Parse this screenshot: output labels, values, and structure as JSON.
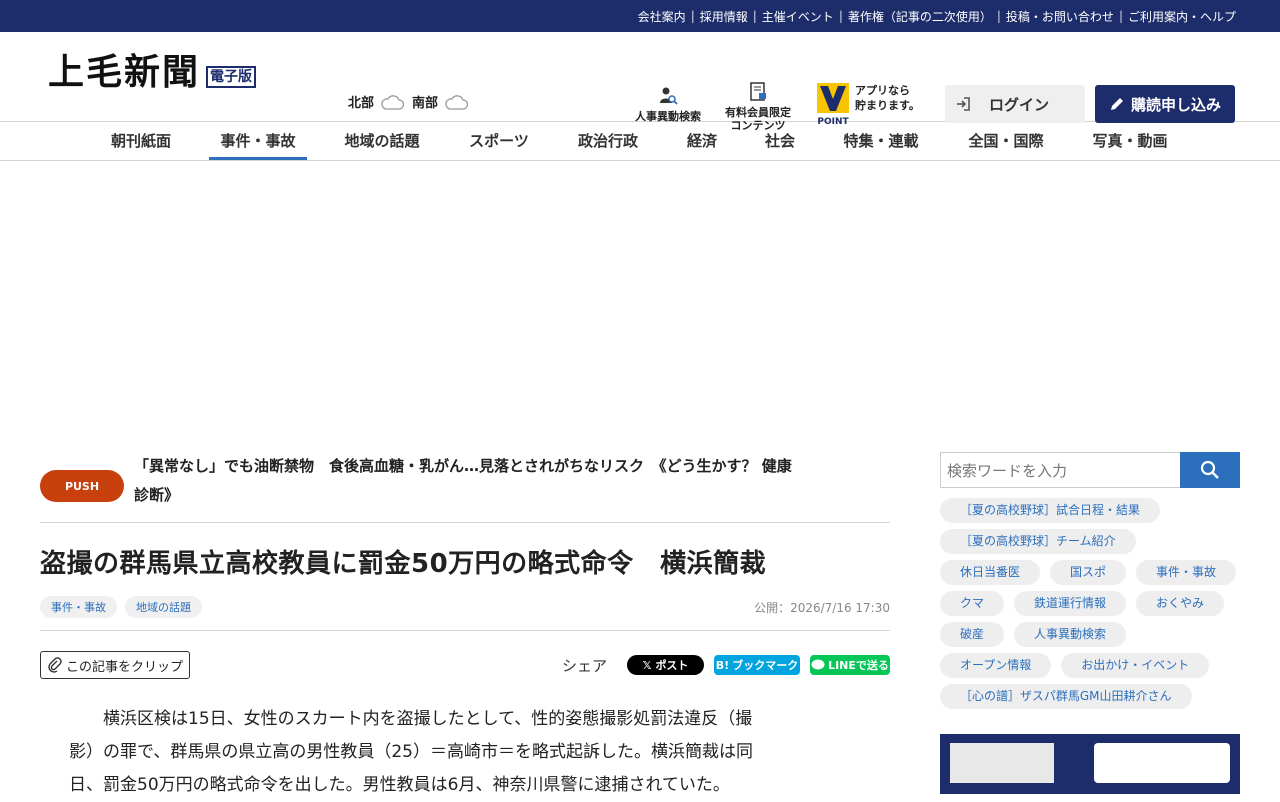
{
  "topbar": {
    "links": [
      "会社案内",
      "採用情報",
      "主催イベント",
      "著作権（記事の二次使用）",
      "投稿・お問い合わせ",
      "ご利用案内・ヘルプ"
    ]
  },
  "header": {
    "logo": "上毛新聞",
    "logo_badge": "電子版",
    "weather": [
      {
        "region": "北部",
        "icon": "cloud-icon"
      },
      {
        "region": "南部",
        "icon": "cloud-icon"
      }
    ],
    "personnel_search": "人事異動検索",
    "paid_content": [
      "有料会員限定",
      "コンテンツ"
    ],
    "point_label": "POINT",
    "point_text": [
      "アプリなら",
      "貯まります。"
    ],
    "login": "ログイン",
    "subscribe": "購読申し込み"
  },
  "nav": {
    "items": [
      "朝刊紙面",
      "事件・事故",
      "地域の話題",
      "スポーツ",
      "政治行政",
      "経済",
      "社会",
      "特集・連載",
      "全国・国際",
      "写真・動画"
    ],
    "active": "事件・事故"
  },
  "push": {
    "badge": "PUSH",
    "headline_line1": "「異常なし」でも油断禁物　食後高血糖・乳がん…見落とされがちなリスク　《どう生かす？ 健康",
    "headline_line2": "診断》"
  },
  "article": {
    "title": "盗撮の群馬県立高校教員に罰金50万円の略式命令　横浜簡裁",
    "tags": [
      "事件・事故",
      "地域の話題"
    ],
    "published": "公開：2026/7/16 17:30",
    "clip_label": "この記事をクリップ",
    "share_label": "シェア",
    "share_x": "ポスト",
    "share_hatena": "ブックマーク",
    "share_line": "LINEで送る",
    "body_lines": [
      "横浜区検は15日、女性のスカート内を盗撮したとして、性的姿態撮影処罰法違反（撮",
      "影）の罪で、群馬県の県立高の男性教員（25）＝高崎市＝を略式起訴した。横浜簡裁は同",
      "日、罰金50万円の略式命令を出した。男性教員は6月、神奈川県警に逮捕されていた。"
    ]
  },
  "sidebar": {
    "search_placeholder": "検索ワードを入力",
    "tags": [
      "［夏の高校野球］試合日程・結果",
      "［夏の高校野球］チーム紹介",
      "休日当番医",
      "国スポ",
      "事件・事故",
      "クマ",
      "鉄道運行情報",
      "おくやみ",
      "破産",
      "人事異動検索",
      "オープン情報",
      "お出かけ・イベント",
      "［心の譜］ザスパ群馬GM山田耕介さん"
    ]
  },
  "colors": {
    "brand_navy": "#1d2d6b",
    "accent_blue": "#2c6fbd",
    "push_orange": "#c8400d",
    "line_green": "#06c755",
    "hatena_blue": "#00a4de"
  }
}
